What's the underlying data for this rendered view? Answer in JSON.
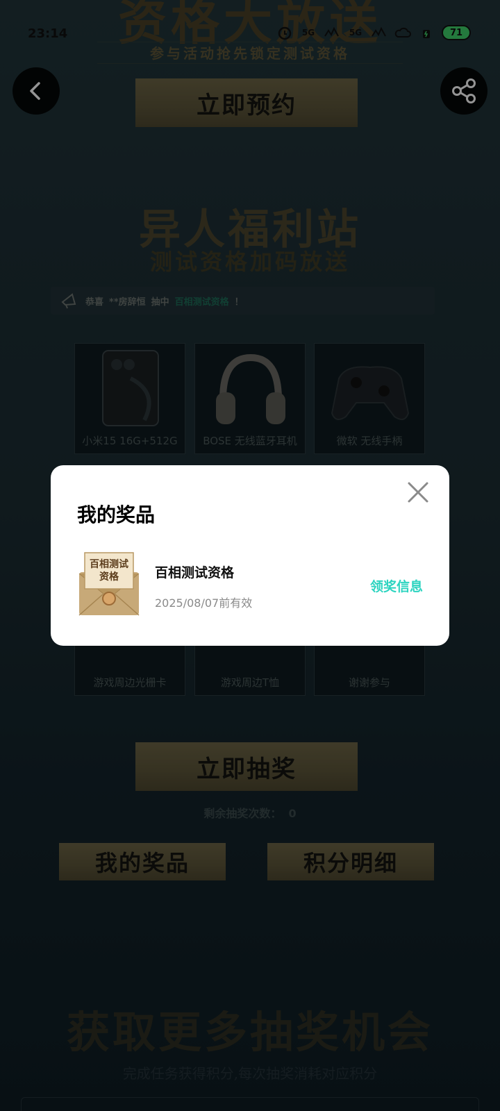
{
  "status_bar": {
    "time": "23:14",
    "battery": "71",
    "network_1": "5G",
    "network_2": "5G"
  },
  "hero": {
    "title": "资格大放送",
    "subtitle": "参与活动抢先锁定测试资格"
  },
  "reserve_button": "立即预约",
  "welfare": {
    "title": "异人福利站",
    "subtitle": "测试资格加码放送"
  },
  "ticker": {
    "prefix": "恭喜",
    "user": "**房辞恒",
    "action": "抽中",
    "prize": "百相测试资格",
    "suffix": "！"
  },
  "prizes": [
    {
      "label": "小米15 16G+512G"
    },
    {
      "label": "BOSE 无线蓝牙耳机"
    },
    {
      "label": "微软 无线手柄"
    },
    {
      "label": "游戏周边光栅卡"
    },
    {
      "label": "游戏周边T恤"
    },
    {
      "label": "谢谢参与"
    }
  ],
  "draw_button": "立即抽奖",
  "remaining": {
    "label": "剩余抽奖次数：",
    "value": "0"
  },
  "my_prizes_button": "我的奖品",
  "points_button": "积分明细",
  "more": {
    "title": "获取更多抽奖机会",
    "subtitle": "完成任务获得积分,每次抽奖消耗对应积分"
  },
  "modal": {
    "title": "我的奖品",
    "prize_name": "百相测试资格",
    "expiry": "2025/08/07前有效",
    "claim_link": "领奖信息",
    "thumb_text_1": "百相测试",
    "thumb_text_2": "资格"
  },
  "colors": {
    "accent": "#2dd4c0",
    "gold_button": "#6d6546",
    "background": "#1c2d33"
  },
  "icons": [
    "back-arrow-icon",
    "share-icon",
    "close-icon",
    "megaphone-icon",
    "alarm-icon"
  ]
}
